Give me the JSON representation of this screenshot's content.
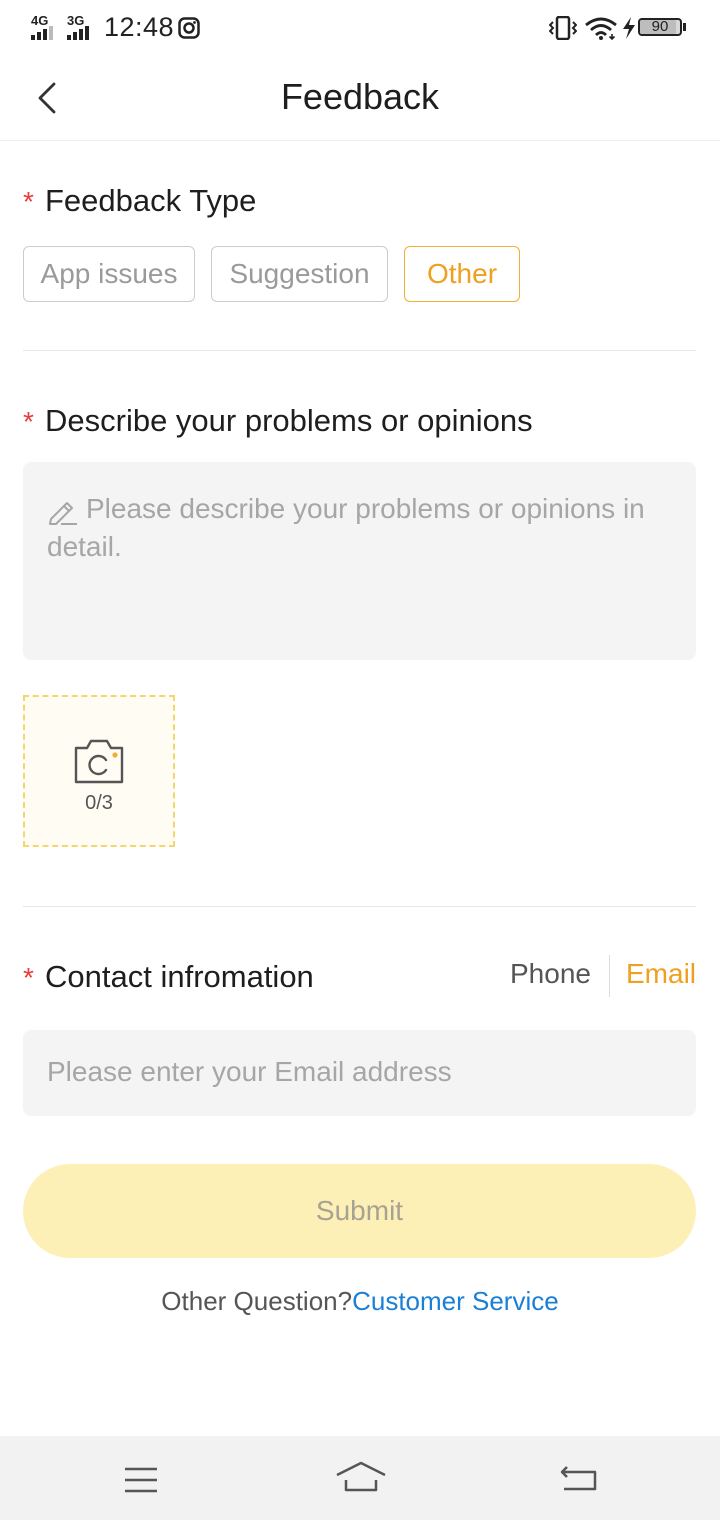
{
  "status_bar": {
    "network_1": "4G",
    "network_2": "3G",
    "time": "12:48",
    "battery": "90",
    "battery_level_pct": 90
  },
  "header": {
    "title": "Feedback"
  },
  "feedback_type": {
    "label": "Feedback Type",
    "required_mark": "*",
    "options": [
      "App issues",
      "Suggestion",
      "Other"
    ],
    "selected": "Other"
  },
  "description": {
    "label": "Describe your problems or opinions",
    "required_mark": "*",
    "placeholder": "Please describe your problems or opinions in detail."
  },
  "upload": {
    "count": "0/3"
  },
  "contact": {
    "label": "Contact infromation",
    "required_mark": "*",
    "tabs": [
      "Phone",
      "Email"
    ],
    "selected_tab": "Email",
    "placeholder": "Please enter your Email address"
  },
  "submit_label": "Submit",
  "footer": {
    "question": "Other Question?",
    "link": "Customer Service"
  },
  "colors": {
    "accent": "#f0a020",
    "required": "#e93b3b",
    "link": "#1a7fd6",
    "submit_bg": "#fdf0b6"
  },
  "icons": [
    "back-arrow-icon",
    "pencil-icon",
    "camera-icon",
    "menu-icon",
    "home-icon",
    "return-icon",
    "vibrate-icon",
    "wifi-icon",
    "charging-icon",
    "instagram-icon"
  ]
}
